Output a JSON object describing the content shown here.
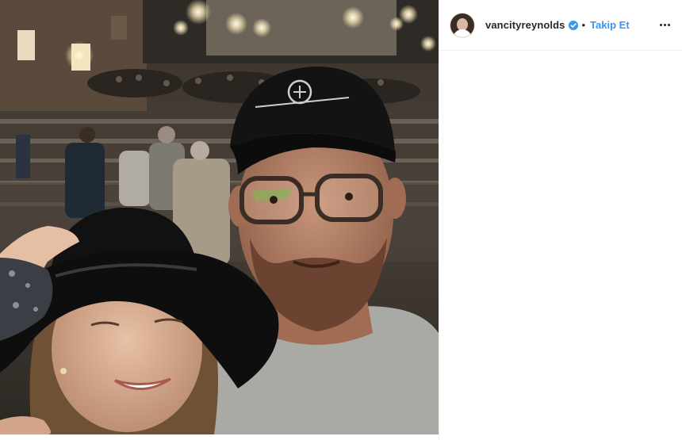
{
  "post": {
    "image_alt": "Selfie of a man in a black cap and glasses with a woman in a black hat at night on outdoor steps",
    "header": {
      "username": "vancityreynolds",
      "separator": "•",
      "follow_label": "Takip Et",
      "verified_icon": "verified-badge-icon",
      "more_icon": "more-options-icon"
    }
  },
  "colors": {
    "follow_blue": "#3897f0",
    "verified_blue": "#3897f0",
    "text_dark": "#262626",
    "divider": "#efefef"
  }
}
